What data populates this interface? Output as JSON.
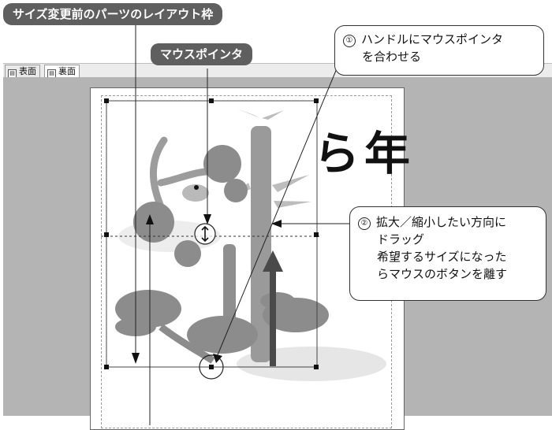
{
  "tabs": [
    {
      "label": "表面",
      "icon": "front-page-icon",
      "active": false
    },
    {
      "label": "裏面",
      "icon": "back-page-icon",
      "active": true
    }
  ],
  "callouts": {
    "layout_frame": "サイズ変更前のパーツのレイアウト枠",
    "mouse_pointer": "マウスポインタ",
    "step1": {
      "number": "①",
      "lines": [
        "ハンドルにマウスポインタ",
        "を合わせる"
      ]
    },
    "step2": {
      "number": "②",
      "lines": [
        "拡大／縮小したい方向に",
        "ドラッグ",
        "希望するサイズになった",
        "らマウスのボタンを離す"
      ]
    }
  },
  "artwork": {
    "calligraphy": "ら年"
  },
  "colors": {
    "callout_dark": "#5f5f5f",
    "workspace": "#b4b4b4",
    "arrow": "#4a4a4a"
  }
}
